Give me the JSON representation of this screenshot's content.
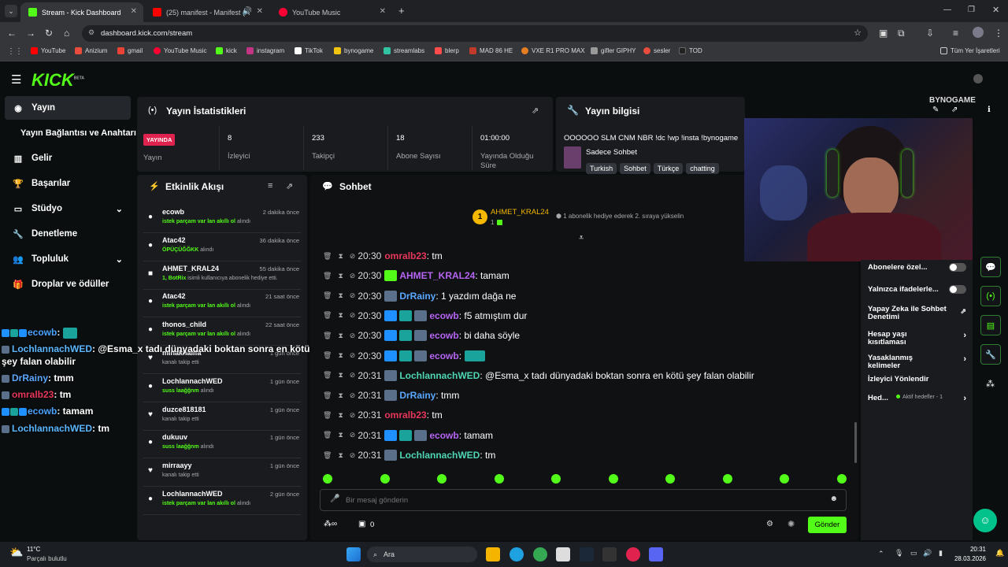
{
  "browser": {
    "tabs": [
      {
        "title": "Stream - Kick Dashboard",
        "color": "#53fc18"
      },
      {
        "title": "(25) manifest - Manifest (A",
        "color": "#ff0000"
      },
      {
        "title": "YouTube Music",
        "color": "#ff0033"
      }
    ],
    "url": "dashboard.kick.com/stream",
    "bookmarks": [
      {
        "label": "YouTube",
        "color": "#ff0000"
      },
      {
        "label": "Anizium",
        "color": "#e74c3c"
      },
      {
        "label": "gmail",
        "color": "#ea4335"
      },
      {
        "label": "YouTube Music",
        "color": "#ff0033"
      },
      {
        "label": "kick",
        "color": "#53fc18"
      },
      {
        "label": "instagram",
        "color": "#c13584"
      },
      {
        "label": "TikTok",
        "color": "#ffffff"
      },
      {
        "label": "bynogame",
        "color": "#f1c40f"
      },
      {
        "label": "streamlabs",
        "color": "#31c3a2"
      },
      {
        "label": "blerp",
        "color": "#ff4b4b"
      },
      {
        "label": "MAD 86 HE",
        "color": "#c0392b"
      },
      {
        "label": "VXE R1 PRO MAX",
        "color": "#e67e22"
      },
      {
        "label": "gifler GIPHY",
        "color": "#999999"
      },
      {
        "label": "sesler",
        "color": "#e74c3c"
      },
      {
        "label": "TOD",
        "color": "#222222"
      }
    ],
    "all_bookmarks": "Tüm Yer İşaretleri"
  },
  "kick": {
    "logo": "KICK",
    "beta": "BETA",
    "brand_color": "#53fc18"
  },
  "sidebar": {
    "items": [
      {
        "label": "Yayın",
        "icon": "broadcast-icon"
      },
      {
        "label": "Yayın Bağlantısı ve Anahtarı",
        "icon": ""
      },
      {
        "label": "Gelir",
        "icon": "chart-icon"
      },
      {
        "label": "Başarılar",
        "icon": "trophy-icon"
      },
      {
        "label": "Stüdyo",
        "icon": "studio-icon"
      },
      {
        "label": "Denetleme",
        "icon": "wrench-icon"
      },
      {
        "label": "Topluluk",
        "icon": "people-icon"
      },
      {
        "label": "Droplar ve ödüller",
        "icon": "gift-icon"
      }
    ]
  },
  "stats": {
    "title": "Yayın İstatistikleri",
    "live_badge": "YAYINDA",
    "live_label": "Yayın",
    "items": [
      {
        "value": "8",
        "label": "İzleyici"
      },
      {
        "value": "233",
        "label": "Takipçi"
      },
      {
        "value": "18",
        "label": "Abone Sayısı"
      },
      {
        "value": "01:00:00",
        "label": "Yayında Olduğu Süre"
      }
    ]
  },
  "stream_info": {
    "title": "Yayın bilgisi",
    "stream_title": "OOOOOO SLM CNM NBR !dc !wp !insta !bynogame",
    "category": "Sadece Sohbet",
    "tags": [
      "Turkish",
      "Sohbet",
      "Türkçe",
      "chatting"
    ]
  },
  "activity": {
    "title": "Etkinlik Akışı",
    "items": [
      {
        "name": "ecowb",
        "time": "2 dakika önce",
        "highlight": "istek parçam var lan akıllı ol",
        "rest": " alındı",
        "icon": "●"
      },
      {
        "name": "Atac42",
        "time": "36 dakika önce",
        "highlight": "ÖPÜÇÜĞĞKK",
        "rest": " alındı",
        "icon": "●"
      },
      {
        "name": "AHMET_KRAL24",
        "time": "55 dakika önce",
        "highlight": "1, BotRix",
        "rest": " isimli kullanıcıya abonelik hediye etti.",
        "icon": "■"
      },
      {
        "name": "Atac42",
        "time": "21 saat önce",
        "highlight": "istek parçam var lan akıllı ol",
        "rest": " alındı",
        "icon": "●"
      },
      {
        "name": "thonos_child",
        "time": "22 saat önce",
        "highlight": "istek parçam var lan akıllı ol",
        "rest": " alındı",
        "icon": "●"
      },
      {
        "name": "minakhalifa",
        "time": "1 gün önce",
        "highlight": "",
        "rest": "kanalı takip etti",
        "icon": "♥"
      },
      {
        "name": "LochlannachWED",
        "time": "1 gün önce",
        "highlight": "suss laağğnm",
        "rest": " alındı",
        "icon": "●"
      },
      {
        "name": "duzce818181",
        "time": "1 gün önce",
        "highlight": "",
        "rest": "kanalı takip etti",
        "icon": "♥"
      },
      {
        "name": "dukuuv",
        "time": "1 gün önce",
        "highlight": "suss laağğnm",
        "rest": " alındı",
        "icon": "●"
      },
      {
        "name": "mirraayy",
        "time": "1 gün önce",
        "highlight": "",
        "rest": "kanalı takip etti",
        "icon": "♥"
      },
      {
        "name": "LochlannachWED",
        "time": "2 gün önce",
        "highlight": "istek parçam var lan akıllı ol",
        "rest": " alındı",
        "icon": "●"
      }
    ]
  },
  "chat": {
    "title": "Sohbet",
    "pinned_user": "AHMET_KRAL24",
    "pinned_rank": "1",
    "pinned_count": "1",
    "pinned_hint": "1 abonelik hediye ederek 2. sıraya yükselin",
    "messages": [
      {
        "time": "20:30",
        "user": "omralb23",
        "color": "#e8375b",
        "badges": 0,
        "text": ": tm"
      },
      {
        "time": "20:30",
        "user": "AHMET_KRAL24",
        "color": "#b565f2",
        "badges": 0,
        "sub": true,
        "text": ": tamam"
      },
      {
        "time": "20:30",
        "user": "DrRainy",
        "color": "#5aa8ff",
        "badges": 1,
        "text": ": 1 yazdım dağa ne"
      },
      {
        "time": "20:30",
        "user": "ecowb",
        "color": "#b565f2",
        "badges": 3,
        "text": ": f5 atmıştım dur"
      },
      {
        "time": "20:30",
        "user": "ecowb",
        "color": "#b565f2",
        "badges": 3,
        "text": ": bi daha söyle"
      },
      {
        "time": "20:30",
        "user": "ecowb",
        "color": "#b565f2",
        "badges": 3,
        "text": ":"
      },
      {
        "time": "20:31",
        "user": "LochlannachWED",
        "color": "#4fd6b4",
        "badges": 1,
        "text": ": @Esma_x tadı dünyadaki boktan sonra en kötü şey falan olabilir"
      },
      {
        "time": "20:31",
        "user": "DrRainy",
        "color": "#5aa8ff",
        "badges": 1,
        "text": ": tmm"
      },
      {
        "time": "20:31",
        "user": "omralb23",
        "color": "#e8375b",
        "badges": 0,
        "text": ": tm"
      },
      {
        "time": "20:31",
        "user": "ecowb",
        "color": "#b565f2",
        "badges": 3,
        "text": ": tamam"
      },
      {
        "time": "20:31",
        "user": "LochlannachWED",
        "color": "#4fd6b4",
        "badges": 1,
        "text": ": tm"
      }
    ],
    "input_placeholder": "Bir mesaj gönderin",
    "count": "0",
    "send_label": "Gönder"
  },
  "overlay_chat": [
    {
      "user": "ecowb",
      "color": "#4aa3ff",
      "text": ":"
    },
    {
      "user": "LochlannachWED",
      "color": "#5ab7ff",
      "text": ": @Esma_x tadı dünyadaki boktan sonra en kötü şey falan olabilir"
    },
    {
      "user": "DrRainy",
      "color": "#5aa8ff",
      "text": ": tmm"
    },
    {
      "user": "omralb23",
      "color": "#e8375b",
      "text": ": tm"
    },
    {
      "user": "ecowb",
      "color": "#4aa3ff",
      "text": ": tamam"
    },
    {
      "user": "LochlannachWED",
      "color": "#5ab7ff",
      "text": ": tm"
    }
  ],
  "chat_settings": {
    "items": [
      {
        "label": "Abonelere özel...",
        "type": "toggle"
      },
      {
        "label": "Yalnızca ifadelerle...",
        "type": "toggle"
      },
      {
        "label": "Yapay Zeka ile Sohbet Denetimi",
        "type": "external"
      },
      {
        "label": "Hesap yaşı kısıtlaması",
        "type": "chevron"
      },
      {
        "label": "Yasaklanmış kelimeler",
        "type": "chevron"
      },
      {
        "label": "İzleyici Yönlendir",
        "type": "none"
      },
      {
        "label": "Hed...",
        "type": "chevron",
        "extra": "Aktif hedefler - 1"
      }
    ]
  },
  "overlay_brand": "BYNOGAME",
  "taskbar": {
    "weather_temp": "11°C",
    "weather_desc": "Parçalı bulutlu",
    "search_label": "Ara",
    "time": "20:31",
    "date": "28.03.2026"
  }
}
